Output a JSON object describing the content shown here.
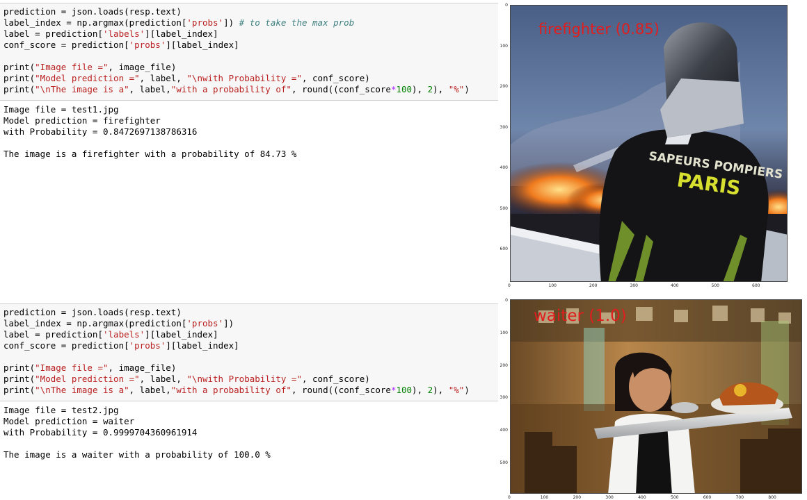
{
  "cell1": {
    "code": [
      [
        "prediction = json.loads(resp.text)"
      ],
      [
        "label_index = np.argmax(prediction[",
        {
          "s": "'probs'"
        },
        "]) ",
        {
          "c": "# to take the max prob"
        }
      ],
      [
        "label = prediction[",
        {
          "s": "'labels'"
        },
        "][label_index]"
      ],
      [
        "conf_score = prediction[",
        {
          "s": "'probs'"
        },
        "][label_index]"
      ],
      [
        ""
      ],
      [
        "print(",
        {
          "s": "\"Image file =\""
        },
        ", image_file)"
      ],
      [
        "print(",
        {
          "s": "\"Model prediction =\""
        },
        ", label, ",
        {
          "s": "\"\\nwith Probability =\""
        },
        ", conf_score)"
      ],
      [
        "print(",
        {
          "s": "\"\\nThe image is a\""
        },
        ", label,",
        {
          "s": "\"with a probability of\""
        },
        ", round((conf_score",
        {
          "o": "*"
        },
        {
          "n": "100"
        },
        "), ",
        {
          "n": "2"
        },
        "), ",
        {
          "s": "\"%\""
        },
        ")"
      ]
    ],
    "output": "Image file = test1.jpg\nModel prediction = firefighter\nwith Probability = 0.8472697138786316\n\nThe image is a firefighter with a probability of 84.73 %"
  },
  "cell2": {
    "code": [
      [
        "prediction = json.loads(resp.text)"
      ],
      [
        "label_index = np.argmax(prediction[",
        {
          "s": "'probs'"
        },
        "])"
      ],
      [
        "label = prediction[",
        {
          "s": "'labels'"
        },
        "][label_index]"
      ],
      [
        "conf_score = prediction[",
        {
          "s": "'probs'"
        },
        "][label_index]"
      ],
      [
        ""
      ],
      [
        "print(",
        {
          "s": "\"Image file =\""
        },
        ", image_file)"
      ],
      [
        "print(",
        {
          "s": "\"Model prediction =\""
        },
        ", label, ",
        {
          "s": "\"\\nwith Probability =\""
        },
        ", conf_score)"
      ],
      [
        "print(",
        {
          "s": "\"\\nThe image is a\""
        },
        ", label,",
        {
          "s": "\"with a probability of\""
        },
        ", round((conf_score",
        {
          "o": "*"
        },
        {
          "n": "100"
        },
        "), ",
        {
          "n": "2"
        },
        "), ",
        {
          "s": "\"%\""
        },
        ")"
      ]
    ],
    "output": "Image file = test2.jpg\nModel prediction = waiter\nwith Probability = 0.9999704360961914\n\nThe image is a waiter with a probability of 100.0 %"
  },
  "plot1": {
    "label": "firefighter (0.85)",
    "xticks": [
      "0",
      "100",
      "200",
      "300",
      "400",
      "500",
      "600"
    ],
    "yticks": [
      "0",
      "100",
      "200",
      "300",
      "400",
      "500",
      "600"
    ],
    "helmet_text": [
      "SAPEURS POMPIERS",
      "PARIS"
    ]
  },
  "plot2": {
    "label": "waiter (1.0)",
    "xticks": [
      "0",
      "100",
      "200",
      "300",
      "400",
      "500",
      "600",
      "700",
      "800"
    ],
    "yticks": [
      "0",
      "100",
      "200",
      "300",
      "400",
      "500"
    ]
  }
}
